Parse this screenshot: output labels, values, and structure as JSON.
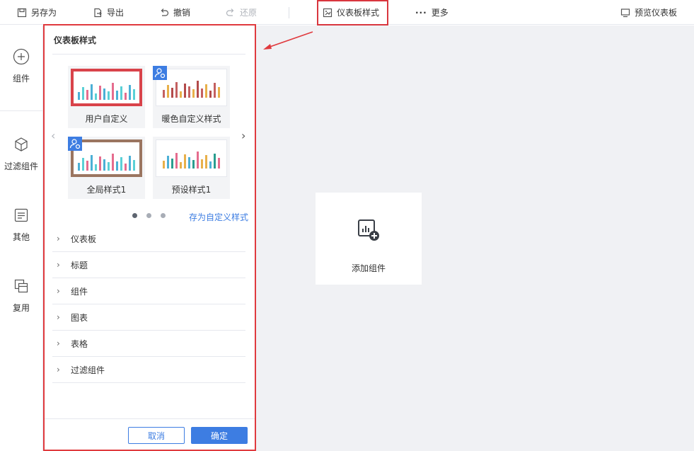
{
  "toolbar": {
    "save_as": "另存为",
    "export": "导出",
    "undo": "撤销",
    "redo": "还原",
    "dashboard_style": "仪表板样式",
    "more": "更多",
    "preview": "预览仪表板"
  },
  "rail": {
    "widget": "组件",
    "filter_widget": "过滤组件",
    "other": "其他",
    "reuse": "复用"
  },
  "panel": {
    "title": "仪表板样式",
    "thumbnails": [
      {
        "label": "用户自定义",
        "selected": true,
        "frame_color": "#d9434a",
        "custom_badge": false
      },
      {
        "label": "暖色自定义样式",
        "selected": false,
        "frame_color": "#f3f4f6",
        "custom_badge": true
      },
      {
        "label": "全局样式1",
        "selected": false,
        "frame_color": "#9b7560",
        "custom_badge": true
      },
      {
        "label": "预设样式1",
        "selected": false,
        "frame_color": "#f3f4f6",
        "custom_badge": false
      }
    ],
    "carousel_page": 1,
    "carousel_pages": 3,
    "save_custom": "存为自定义样式",
    "sections": [
      "仪表板",
      "标题",
      "组件",
      "图表",
      "表格",
      "过滤组件"
    ],
    "cancel": "取消",
    "confirm": "确定"
  },
  "canvas": {
    "add_widget": "添加组件"
  },
  "colors": {
    "accent": "#3d7de2",
    "highlight": "#e03a3e",
    "bar_cool": [
      "#4cb0d6",
      "#5ad0d6",
      "#e56c8e"
    ],
    "bar_warm": [
      "#c46060",
      "#e8b04a",
      "#b34b4b"
    ]
  }
}
